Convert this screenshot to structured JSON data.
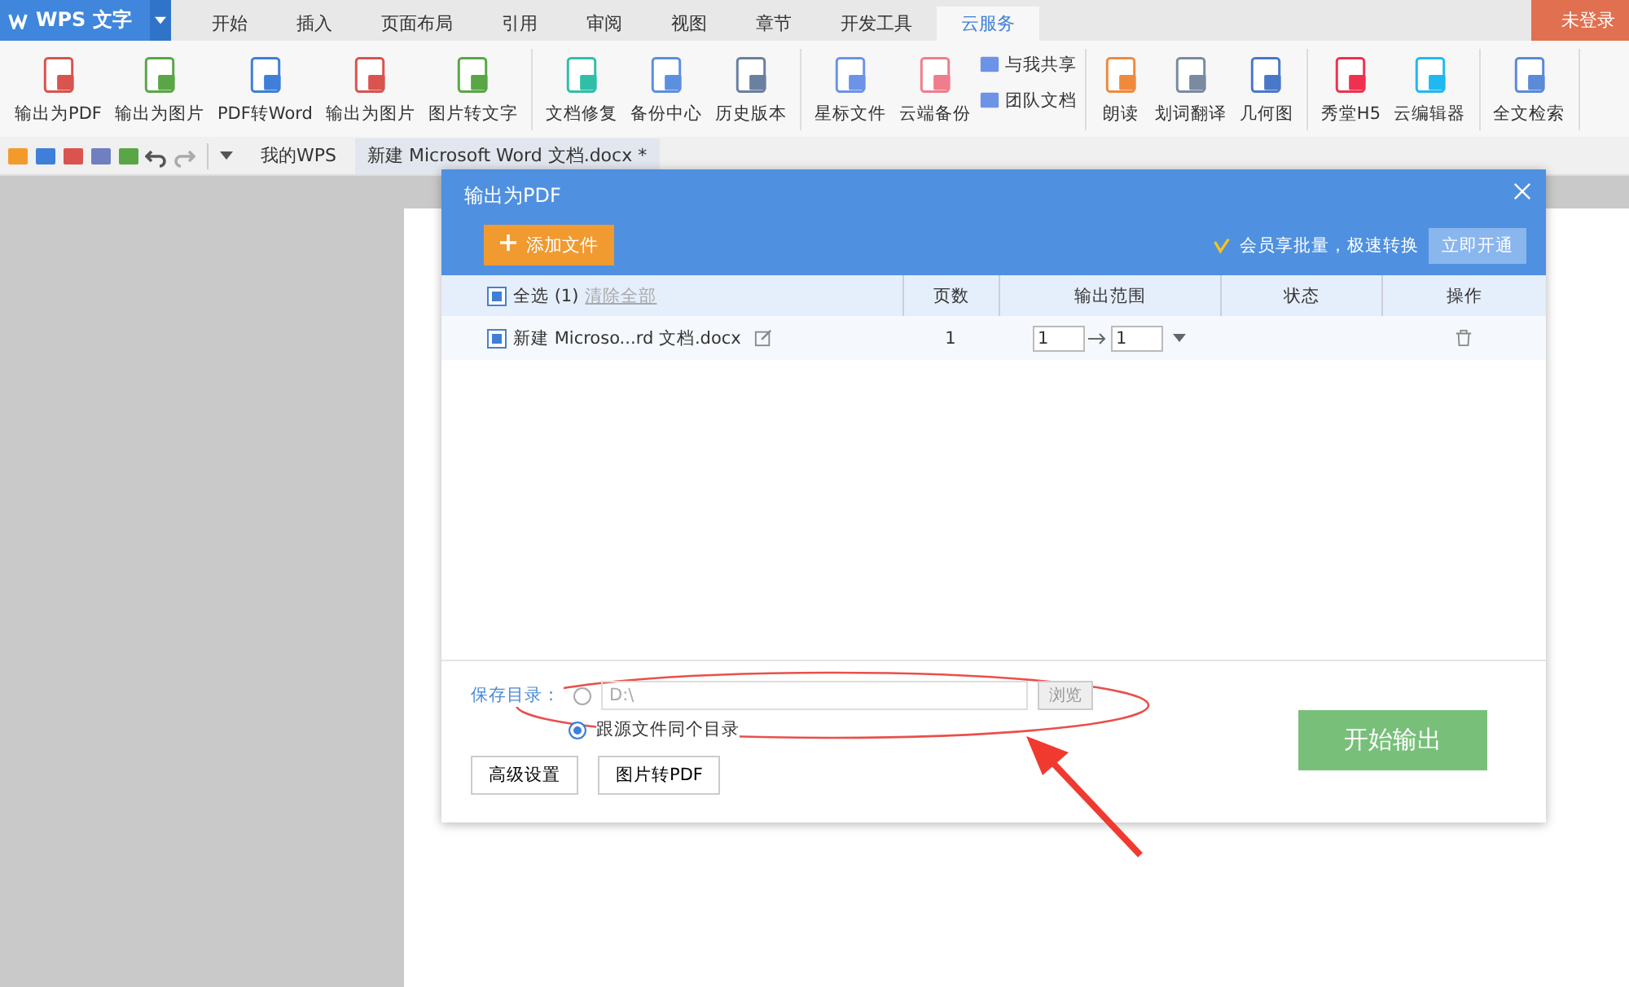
{
  "app": {
    "logo": "WPS 文字",
    "login": "未登录"
  },
  "tabs": [
    {
      "label": "开始",
      "selected": false
    },
    {
      "label": "插入",
      "selected": false
    },
    {
      "label": "页面布局",
      "selected": false
    },
    {
      "label": "引用",
      "selected": false
    },
    {
      "label": "审阅",
      "selected": false
    },
    {
      "label": "视图",
      "selected": false
    },
    {
      "label": "章节",
      "selected": false
    },
    {
      "label": "开发工具",
      "selected": false
    },
    {
      "label": "云服务",
      "selected": true
    }
  ],
  "ribbon": [
    [
      {
        "kind": "large",
        "label": "输出为PDF"
      },
      {
        "kind": "large",
        "label": "输出为图片"
      },
      {
        "kind": "large",
        "label": "PDF转Word"
      },
      {
        "kind": "large",
        "label": "输出为图片"
      },
      {
        "kind": "large",
        "label": "图片转文字"
      }
    ],
    [
      {
        "kind": "large",
        "label": "文档修复"
      },
      {
        "kind": "large",
        "label": "备份中心"
      },
      {
        "kind": "large",
        "label": "历史版本"
      }
    ],
    [
      {
        "kind": "large",
        "label": "星标文件"
      },
      {
        "kind": "large",
        "label": "云端备份"
      },
      {
        "kind": "stack",
        "items": [
          "与我共享",
          "团队文档"
        ]
      }
    ],
    [
      {
        "kind": "large",
        "label": "朗读"
      },
      {
        "kind": "large",
        "label": "划词翻译"
      },
      {
        "kind": "large",
        "label": "几何图"
      }
    ],
    [
      {
        "kind": "large",
        "label": "秀堂H5"
      },
      {
        "kind": "large",
        "label": "云编辑器"
      }
    ],
    [
      {
        "kind": "large",
        "label": "全文检索"
      }
    ]
  ],
  "doc_tabs": [
    {
      "label": "我的WPS",
      "selected": false
    },
    {
      "label": "新建 Microsoft Word 文档.docx *",
      "selected": true
    }
  ],
  "dialog": {
    "title": "输出为PDF",
    "add_button": "添加文件",
    "promo": "会员享批量，极速转换",
    "promo_button": "立即开通",
    "header": {
      "select_all": "全选 (1)",
      "checked": true,
      "clear": "清除全部",
      "columns": [
        "页数",
        "输出范围",
        "状态",
        "操作"
      ]
    },
    "rows": [
      {
        "name": "新建 Microso...rd 文档.docx",
        "checked": true,
        "pages": "1",
        "from": "1",
        "to": "1"
      }
    ],
    "save_label": "保存目录：",
    "options": [
      {
        "kind": "path",
        "value": "D:\\",
        "button": "浏览",
        "selected": false
      },
      {
        "kind": "text",
        "label": "跟源文件同个目录",
        "selected": true
      }
    ],
    "buttons": [
      "高级设置",
      "图片转PDF"
    ],
    "start": "开始输出"
  }
}
